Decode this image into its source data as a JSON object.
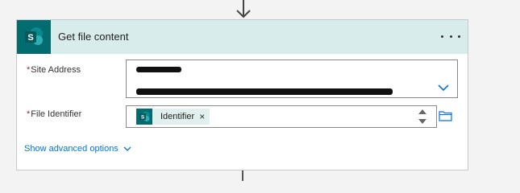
{
  "card": {
    "title": "Get file content",
    "app_icon": "sharepoint-icon",
    "app_icon_letter": "S",
    "more_icon": "more-options-icon"
  },
  "fields": {
    "site_address": {
      "required_mark": "*",
      "label": "Site Address"
    },
    "file_identifier": {
      "required_mark": "*",
      "label": "File Identifier",
      "token_label": "Identifier",
      "token_icon_letter": "S",
      "token_remove": "×"
    }
  },
  "advanced": {
    "label": "Show advanced options"
  },
  "colors": {
    "header_bg": "#d9ecec",
    "sharepoint_teal": "#036c70",
    "link_blue": "#0078d4",
    "required_red": "#a4262c"
  }
}
